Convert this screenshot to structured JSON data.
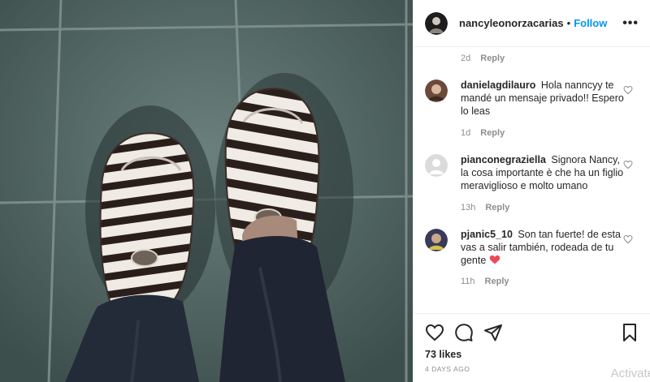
{
  "post": {
    "photo_icon": "zebra-print-loafers-photo",
    "likes": "73 likes",
    "date": "4 DAYS AGO"
  },
  "header": {
    "username": "nancyleonorzacarias",
    "separator": "•",
    "follow_label": "Follow",
    "more_icon": "more-options-icon",
    "more_label": "•••"
  },
  "first_meta": {
    "time": "2d",
    "reply": "Reply"
  },
  "comments": [
    {
      "username": "danielagdilauro",
      "text": "Hola nanncyy te mandé un mensaje privado!! Espero lo leas",
      "time": "1d",
      "reply": "Reply"
    },
    {
      "username": "pianconegraziella",
      "text": "Signora Nancy, la cosa importante è che ha un figlio meraviglioso e molto umano",
      "time": "13h",
      "reply": "Reply"
    },
    {
      "username": "pjanic5_10",
      "text": "Son tan fuerte! de esta vas a salir también, rodeada de tu gente",
      "time": "11h",
      "reply": "Reply"
    }
  ],
  "icons": {
    "like": "heart-outline-icon",
    "comment": "comment-bubble-icon",
    "share": "paper-plane-icon",
    "save": "bookmark-icon"
  },
  "colors": {
    "follow": "#0095f6",
    "secondary_text": "#8e8e8e",
    "red_heart": "#ed4956"
  },
  "watermark": "Activate"
}
